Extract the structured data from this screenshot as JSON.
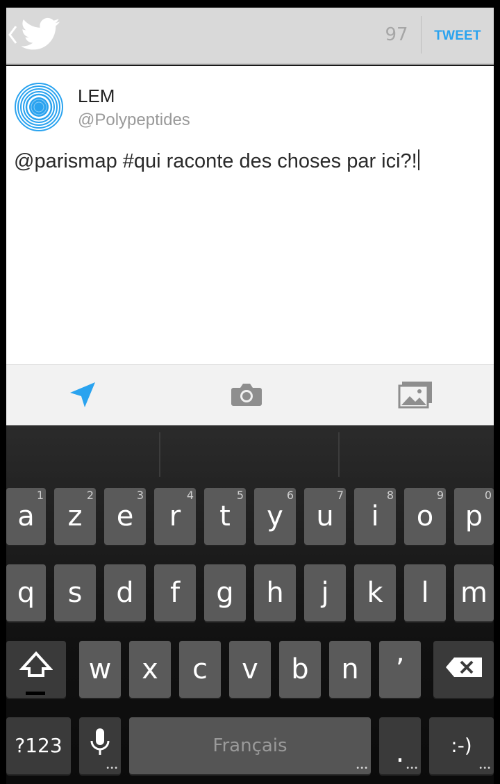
{
  "header": {
    "char_count": "97",
    "tweet_label": "TWEET"
  },
  "compose": {
    "name": "LEM",
    "handle": "@Polypeptides",
    "text": "@parismap #qui raconte des choses par ici?!"
  },
  "toolbar": {
    "items": [
      "location-arrow-icon",
      "camera-icon",
      "gallery-icon"
    ]
  },
  "keyboard": {
    "row1": [
      {
        "label": "a",
        "hint": "1"
      },
      {
        "label": "z",
        "hint": "2"
      },
      {
        "label": "e",
        "hint": "3"
      },
      {
        "label": "r",
        "hint": "4"
      },
      {
        "label": "t",
        "hint": "5"
      },
      {
        "label": "y",
        "hint": "6"
      },
      {
        "label": "u",
        "hint": "7"
      },
      {
        "label": "i",
        "hint": "8"
      },
      {
        "label": "o",
        "hint": "9"
      },
      {
        "label": "p",
        "hint": "0"
      }
    ],
    "row2": [
      "q",
      "s",
      "d",
      "f",
      "g",
      "h",
      "j",
      "k",
      "l",
      "m"
    ],
    "row3": [
      "w",
      "x",
      "c",
      "v",
      "b",
      "n",
      "’"
    ],
    "row4": {
      "symbols": "?123",
      "space": "Français",
      "period": ".",
      "smiley": ":-)"
    }
  },
  "colors": {
    "accent": "#2aa3ef",
    "action_bar": "#d9d9d9",
    "key": "#5a5a5a"
  }
}
